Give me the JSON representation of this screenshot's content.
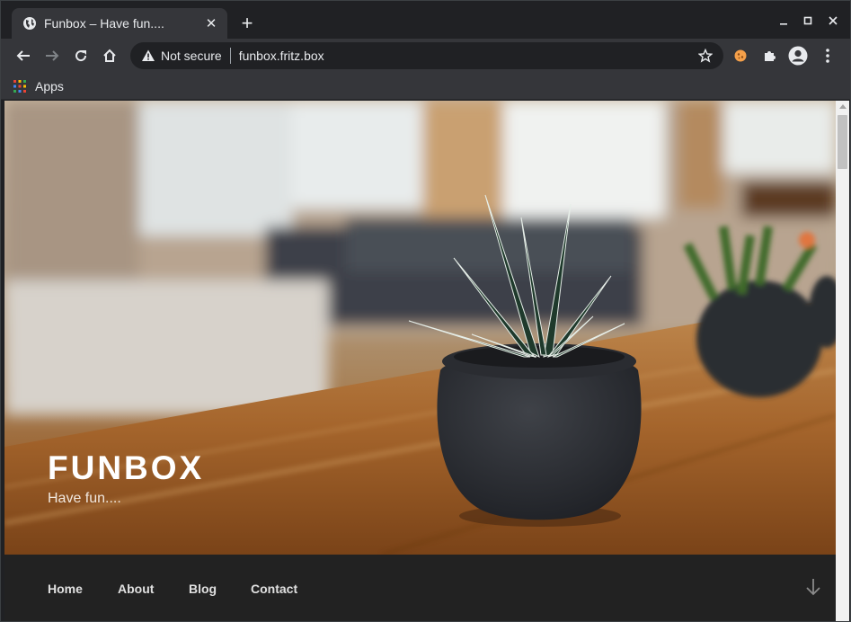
{
  "browser": {
    "tab_title": "Funbox – Have fun....",
    "tab_close": "✕",
    "new_tab": "+",
    "security_label": "Not secure",
    "url": "funbox.fritz.box",
    "bookmarks": [
      {
        "label": "Apps",
        "icon": "apps-grid-icon"
      }
    ]
  },
  "site": {
    "title": "FUNBOX",
    "description": "Have fun....",
    "nav": [
      {
        "label": "Home"
      },
      {
        "label": "About"
      },
      {
        "label": "Blog"
      },
      {
        "label": "Contact"
      }
    ]
  },
  "colors": {
    "tab_strip": "#202124",
    "toolbar": "#35363a",
    "nav_bg": "#222222",
    "text": "#e8eaed"
  }
}
